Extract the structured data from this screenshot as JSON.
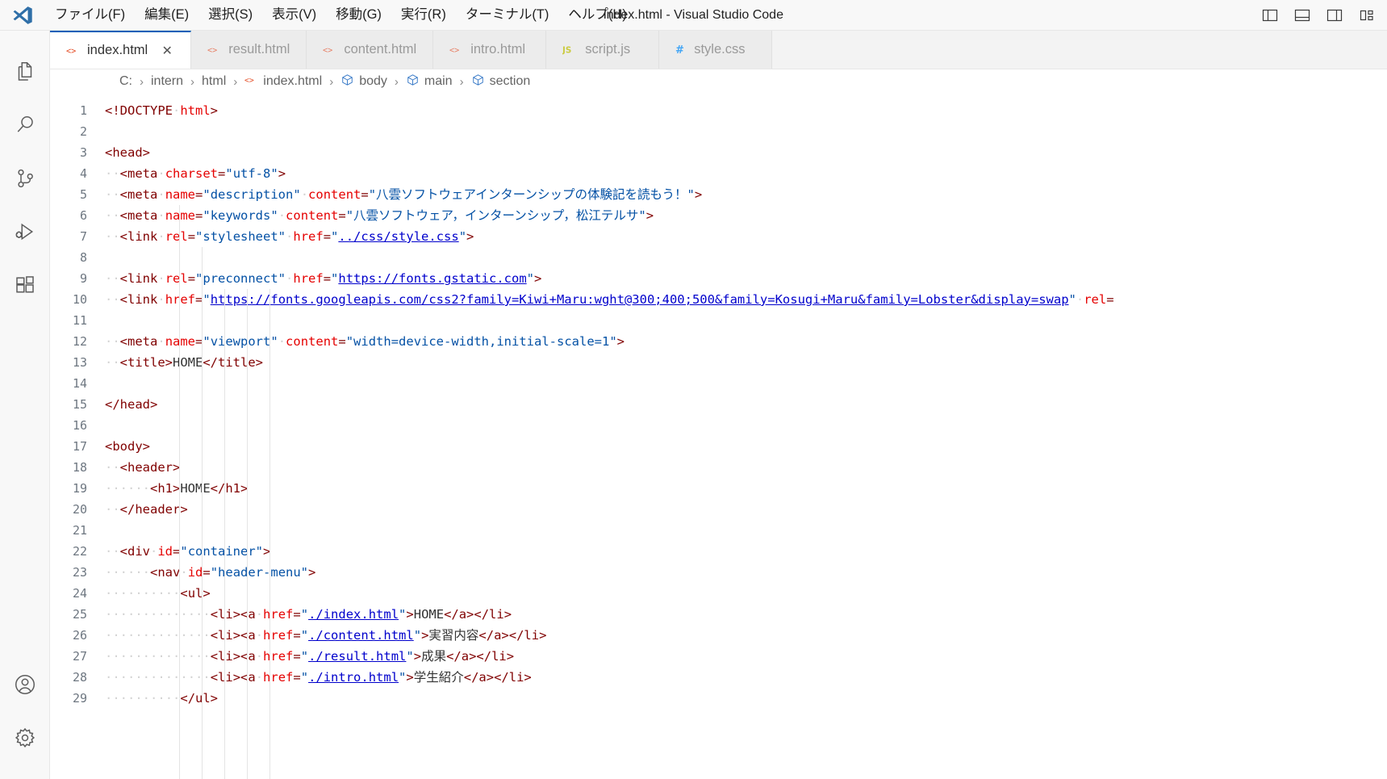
{
  "window": {
    "title": "index.html - Visual Studio Code",
    "logo_icon": "vscode-logo-icon"
  },
  "menubar": {
    "items": [
      {
        "label": "ファイル(F)",
        "name": "menu-file"
      },
      {
        "label": "編集(E)",
        "name": "menu-edit"
      },
      {
        "label": "選択(S)",
        "name": "menu-selection"
      },
      {
        "label": "表示(V)",
        "name": "menu-view"
      },
      {
        "label": "移動(G)",
        "name": "menu-go"
      },
      {
        "label": "実行(R)",
        "name": "menu-run"
      },
      {
        "label": "ターミナル(T)",
        "name": "menu-terminal"
      },
      {
        "label": "ヘルプ(H)",
        "name": "menu-help"
      }
    ]
  },
  "titlebar_actions": [
    {
      "name": "toggle-primary-sidebar-icon",
      "tooltip": "Toggle Primary Side Bar"
    },
    {
      "name": "toggle-panel-icon",
      "tooltip": "Toggle Panel"
    },
    {
      "name": "toggle-secondary-sidebar-icon",
      "tooltip": "Toggle Secondary Side Bar"
    },
    {
      "name": "customize-layout-icon",
      "tooltip": "Customize Layout"
    }
  ],
  "activitybar": {
    "top_items": [
      {
        "name": "explorer-icon",
        "label": "Explorer"
      },
      {
        "name": "search-icon",
        "label": "Search"
      },
      {
        "name": "source-control-icon",
        "label": "Source Control"
      },
      {
        "name": "run-and-debug-icon",
        "label": "Run and Debug"
      },
      {
        "name": "extensions-icon",
        "label": "Extensions"
      }
    ],
    "bottom_items": [
      {
        "name": "accounts-icon",
        "label": "Accounts"
      },
      {
        "name": "settings-gear-icon",
        "label": "Manage"
      }
    ]
  },
  "tabs": [
    {
      "label": "index.html",
      "icon": "html-file-icon",
      "icon_char": "<>",
      "icon_color": "#e44d26",
      "active": true,
      "close": "✕"
    },
    {
      "label": "result.html",
      "icon": "html-file-icon",
      "icon_char": "<>",
      "icon_color": "#e44d26",
      "active": false,
      "close": ""
    },
    {
      "label": "content.html",
      "icon": "html-file-icon",
      "icon_char": "<>",
      "icon_color": "#e44d26",
      "active": false,
      "close": ""
    },
    {
      "label": "intro.html",
      "icon": "html-file-icon",
      "icon_char": "<>",
      "icon_color": "#e44d26",
      "active": false,
      "close": ""
    },
    {
      "label": "script.js",
      "icon": "js-file-icon",
      "icon_char": "JS",
      "icon_color": "#cbcb41",
      "active": false,
      "close": ""
    },
    {
      "label": "style.css",
      "icon": "css-file-icon",
      "icon_char": "#",
      "icon_color": "#42a5f5",
      "active": false,
      "close": ""
    }
  ],
  "breadcrumbs": [
    {
      "label": "C:",
      "icon": ""
    },
    {
      "label": "intern",
      "icon": ""
    },
    {
      "label": "html",
      "icon": ""
    },
    {
      "label": "index.html",
      "icon": "html-file-icon"
    },
    {
      "label": "body",
      "icon": "symbol-field-icon"
    },
    {
      "label": "main",
      "icon": "symbol-field-icon"
    },
    {
      "label": "section",
      "icon": "symbol-field-icon"
    }
  ],
  "breadcrumb_separator": "›",
  "editor": {
    "language": "html",
    "first_line": 1,
    "lines": [
      {
        "n": 1,
        "html": "<span class=\"tg\">&lt;!DOCTYPE</span><span class=\"ws\">·</span><span class=\"at\">html</span><span class=\"tg\">&gt;</span>"
      },
      {
        "n": 2,
        "html": ""
      },
      {
        "n": 3,
        "html": "<span class=\"tg\">&lt;head&gt;</span>"
      },
      {
        "n": 4,
        "html": "<span class=\"ws\">··</span><span class=\"tg\">&lt;meta</span><span class=\"ws\">·</span><span class=\"at\">charset</span><span class=\"tg\">=</span><span class=\"st\">\"utf-8\"</span><span class=\"tg\">&gt;</span>"
      },
      {
        "n": 5,
        "html": "<span class=\"ws\">··</span><span class=\"tg\">&lt;meta</span><span class=\"ws\">·</span><span class=\"at\">name</span><span class=\"tg\">=</span><span class=\"st\">\"description\"</span><span class=\"ws\">·</span><span class=\"at\">content</span><span class=\"tg\">=</span><span class=\"st\">\"八雲ソフトウェアインターンシップの体験記を読もう！\"</span><span class=\"tg\">&gt;</span>"
      },
      {
        "n": 6,
        "html": "<span class=\"ws\">··</span><span class=\"tg\">&lt;meta</span><span class=\"ws\">·</span><span class=\"at\">name</span><span class=\"tg\">=</span><span class=\"st\">\"keywords\"</span><span class=\"ws\">·</span><span class=\"at\">content</span><span class=\"tg\">=</span><span class=\"st\">\"八雲ソフトウェア，インターンシップ，松江テルサ\"</span><span class=\"tg\">&gt;</span>"
      },
      {
        "n": 7,
        "html": "<span class=\"ws\">··</span><span class=\"tg\">&lt;link</span><span class=\"ws\">·</span><span class=\"at\">rel</span><span class=\"tg\">=</span><span class=\"st\">\"stylesheet\"</span><span class=\"ws\">·</span><span class=\"at\">href</span><span class=\"tg\">=</span><span class=\"st\">\"</span><span class=\"lk\">../css/style.css</span><span class=\"st\">\"</span><span class=\"tg\">&gt;</span>"
      },
      {
        "n": 8,
        "html": ""
      },
      {
        "n": 9,
        "html": "<span class=\"ws\">··</span><span class=\"tg\">&lt;link</span><span class=\"ws\">·</span><span class=\"at\">rel</span><span class=\"tg\">=</span><span class=\"st\">\"preconnect\"</span><span class=\"ws\">·</span><span class=\"at\">href</span><span class=\"tg\">=</span><span class=\"st\">\"</span><span class=\"lk\">https://fonts.gstatic.com</span><span class=\"st\">\"</span><span class=\"tg\">&gt;</span>"
      },
      {
        "n": 10,
        "html": "<span class=\"ws\">··</span><span class=\"tg\">&lt;link</span><span class=\"ws\">·</span><span class=\"at\">href</span><span class=\"tg\">=</span><span class=\"st\">\"</span><span class=\"lk\">https://fonts.googleapis.com/css2?family=Kiwi+Maru:wght@300;400;500&amp;family=Kosugi+Maru&amp;family=Lobster&amp;display=swap</span><span class=\"st\">\"</span><span class=\"ws\">·</span><span class=\"at\">rel</span><span class=\"tg\">=</span>"
      },
      {
        "n": 11,
        "html": ""
      },
      {
        "n": 12,
        "html": "<span class=\"ws\">··</span><span class=\"tg\">&lt;meta</span><span class=\"ws\">·</span><span class=\"at\">name</span><span class=\"tg\">=</span><span class=\"st\">\"viewport\"</span><span class=\"ws\">·</span><span class=\"at\">content</span><span class=\"tg\">=</span><span class=\"st\">\"width=device-width,initial-scale=1\"</span><span class=\"tg\">&gt;</span>"
      },
      {
        "n": 13,
        "html": "<span class=\"ws\">··</span><span class=\"tg\">&lt;title&gt;</span><span class=\"tx\">HOME</span><span class=\"tg\">&lt;/title&gt;</span>"
      },
      {
        "n": 14,
        "html": ""
      },
      {
        "n": 15,
        "html": "<span class=\"tg\">&lt;/head&gt;</span>"
      },
      {
        "n": 16,
        "html": ""
      },
      {
        "n": 17,
        "html": "<span class=\"tg\">&lt;body&gt;</span>"
      },
      {
        "n": 18,
        "html": "<span class=\"ws\">··</span><span class=\"tg\">&lt;header&gt;</span>"
      },
      {
        "n": 19,
        "html": "<span class=\"ws\">··</span><span class=\"ws\">··</span><span class=\"ws\">··</span><span class=\"tg\">&lt;h1&gt;</span><span class=\"tx\">HOME</span><span class=\"tg\">&lt;/h1&gt;</span>"
      },
      {
        "n": 20,
        "html": "<span class=\"ws\">··</span><span class=\"tg\">&lt;/header&gt;</span>"
      },
      {
        "n": 21,
        "html": ""
      },
      {
        "n": 22,
        "html": "<span class=\"ws\">··</span><span class=\"tg\">&lt;div</span><span class=\"ws\">·</span><span class=\"at\">id</span><span class=\"tg\">=</span><span class=\"st\">\"container\"</span><span class=\"tg\">&gt;</span>"
      },
      {
        "n": 23,
        "html": "<span class=\"ws\">··</span><span class=\"ws\">··</span><span class=\"ws\">··</span><span class=\"tg\">&lt;nav</span><span class=\"ws\">·</span><span class=\"at\">id</span><span class=\"tg\">=</span><span class=\"st\">\"header-menu\"</span><span class=\"tg\">&gt;</span>"
      },
      {
        "n": 24,
        "html": "<span class=\"ws\">··</span><span class=\"ws\">··</span><span class=\"ws\">··</span><span class=\"ws\">··</span><span class=\"ws\">··</span><span class=\"tg\">&lt;ul&gt;</span>"
      },
      {
        "n": 25,
        "html": "<span class=\"ws\">··</span><span class=\"ws\">··</span><span class=\"ws\">··</span><span class=\"ws\">··</span><span class=\"ws\">··</span><span class=\"ws\">··</span><span class=\"ws\">··</span><span class=\"tg\">&lt;li&gt;&lt;a</span><span class=\"ws\">·</span><span class=\"at\">href</span><span class=\"tg\">=</span><span class=\"st\">\"</span><span class=\"lk\">./index.html</span><span class=\"st\">\"</span><span class=\"tg\">&gt;</span><span class=\"tx\">HOME</span><span class=\"tg\">&lt;/a&gt;&lt;/li&gt;</span>"
      },
      {
        "n": 26,
        "html": "<span class=\"ws\">··</span><span class=\"ws\">··</span><span class=\"ws\">··</span><span class=\"ws\">··</span><span class=\"ws\">··</span><span class=\"ws\">··</span><span class=\"ws\">··</span><span class=\"tg\">&lt;li&gt;&lt;a</span><span class=\"ws\">·</span><span class=\"at\">href</span><span class=\"tg\">=</span><span class=\"st\">\"</span><span class=\"lk\">./content.html</span><span class=\"st\">\"</span><span class=\"tg\">&gt;</span><span class=\"tx\">実習内容</span><span class=\"tg\">&lt;/a&gt;&lt;/li&gt;</span>"
      },
      {
        "n": 27,
        "html": "<span class=\"ws\">··</span><span class=\"ws\">··</span><span class=\"ws\">··</span><span class=\"ws\">··</span><span class=\"ws\">··</span><span class=\"ws\">··</span><span class=\"ws\">··</span><span class=\"tg\">&lt;li&gt;&lt;a</span><span class=\"ws\">·</span><span class=\"at\">href</span><span class=\"tg\">=</span><span class=\"st\">\"</span><span class=\"lk\">./result.html</span><span class=\"st\">\"</span><span class=\"tg\">&gt;</span><span class=\"tx\">成果</span><span class=\"tg\">&lt;/a&gt;&lt;/li&gt;</span>"
      },
      {
        "n": 28,
        "html": "<span class=\"ws\">··</span><span class=\"ws\">··</span><span class=\"ws\">··</span><span class=\"ws\">··</span><span class=\"ws\">··</span><span class=\"ws\">··</span><span class=\"ws\">··</span><span class=\"tg\">&lt;li&gt;&lt;a</span><span class=\"ws\">·</span><span class=\"at\">href</span><span class=\"tg\">=</span><span class=\"st\">\"</span><span class=\"lk\">./intro.html</span><span class=\"st\">\"</span><span class=\"tg\">&gt;</span><span class=\"tx\">学生紹介</span><span class=\"tg\">&lt;/a&gt;&lt;/li&gt;</span>"
      },
      {
        "n": 29,
        "html": "<span class=\"ws\">··</span><span class=\"ws\">··</span><span class=\"ws\">··</span><span class=\"ws\">··</span><span class=\"ws\">··</span><span class=\"tg\">&lt;/ul&gt;</span>"
      }
    ]
  },
  "colors": {
    "accent": "#005fb8",
    "tag": "#800000",
    "attribute": "#e50000",
    "string": "#0451a5",
    "link": "#0000cc",
    "plain_text": "#333333",
    "titlebar_bg": "#f8f8f8",
    "tabbar_bg": "#f3f3f3",
    "editor_bg": "#ffffff"
  }
}
